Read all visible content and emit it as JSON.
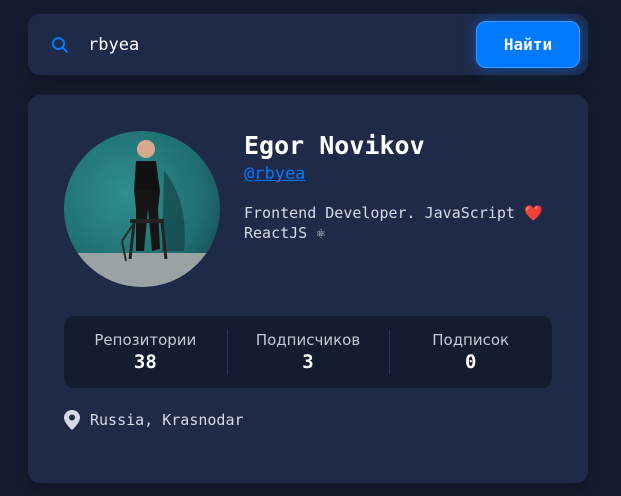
{
  "search": {
    "value": "rbyea",
    "button_label": "Найти"
  },
  "profile": {
    "name": "Egor Novikov",
    "login": "@rbyea",
    "bio": "Frontend Developer. JavaScript ❤️ ReactJS ⚛",
    "location": "Russia, Krasnodar"
  },
  "stats": [
    {
      "label": "Репозитории",
      "value": "38"
    },
    {
      "label": "Подписчиков",
      "value": "3"
    },
    {
      "label": "Подписок",
      "value": "0"
    }
  ],
  "colors": {
    "background": "#141d2f",
    "card": "#1f2a48",
    "accent": "#0079ff",
    "stats_bg": "#141d2f"
  },
  "icons": {
    "search": "search-icon",
    "location": "location-pin-icon"
  }
}
